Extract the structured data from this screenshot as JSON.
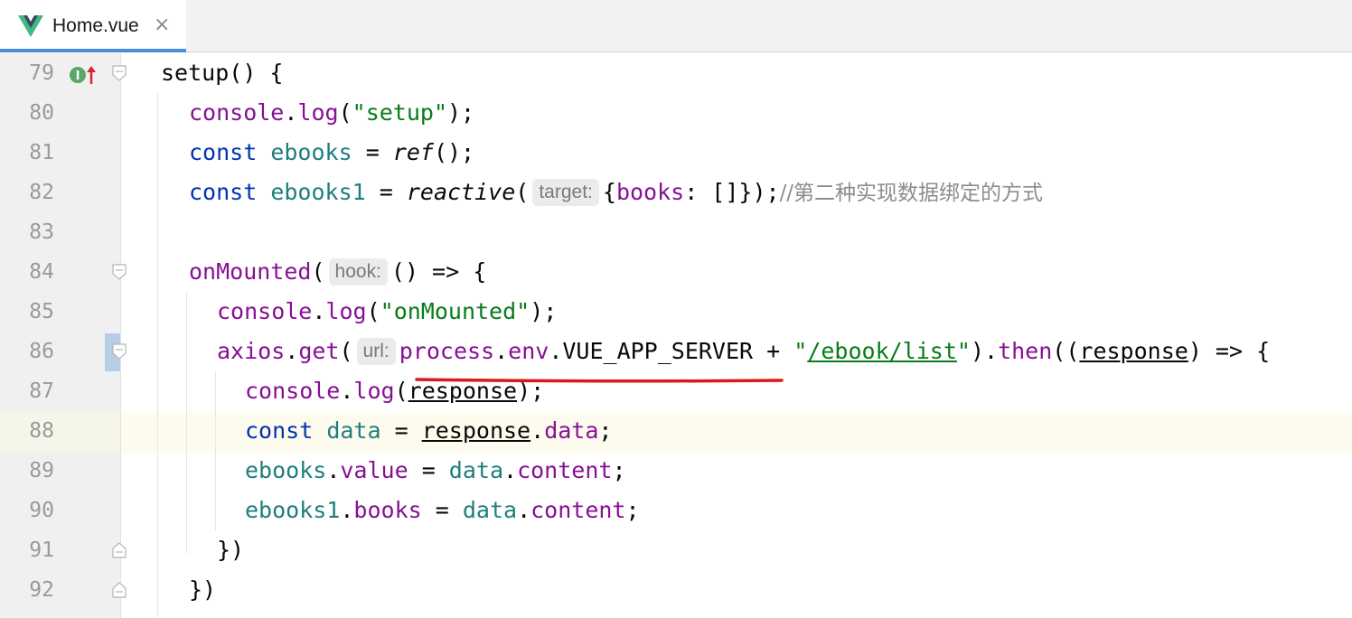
{
  "tab": {
    "label": "Home.vue",
    "icon": "vue-icon",
    "close": "×"
  },
  "colors": {
    "keyword": "#0033b3",
    "function": "#871094",
    "variable": "#1e7e7e",
    "string": "#067d17",
    "comment": "#8c8c8c",
    "underline_mark": "#e0141e"
  },
  "gutter_icons": [
    {
      "line": "79",
      "name": "implementing-method-icon",
      "letter": "I"
    }
  ],
  "lines": [
    {
      "num": "79",
      "t": [
        "setup",
        "() {"
      ]
    },
    {
      "num": "80",
      "t": [
        "console",
        ".",
        "log",
        "(",
        "\"setup\"",
        ");"
      ]
    },
    {
      "num": "81",
      "t": [
        "const",
        " ",
        "ebooks",
        " = ",
        "ref",
        "();"
      ]
    },
    {
      "num": "82",
      "t": [
        "const",
        " ",
        "ebooks1",
        " = ",
        "reactive",
        "(",
        "target:",
        "{",
        "books",
        ": []});",
        "//第二种实现数据绑定的方式"
      ]
    },
    {
      "num": "83",
      "t": []
    },
    {
      "num": "84",
      "t": [
        "onMounted",
        "(",
        "hook:",
        "() => {"
      ]
    },
    {
      "num": "85",
      "t": [
        "console",
        ".",
        "log",
        "(",
        "\"onMounted\"",
        ");"
      ]
    },
    {
      "num": "86",
      "t": [
        "axios",
        ".",
        "get",
        "(",
        "url:",
        "process",
        ".",
        "env",
        ".VUE_APP_SERVER + ",
        "\"",
        "/ebook/list",
        "\"",
        ").",
        "then",
        "((",
        "response",
        ") => {"
      ]
    },
    {
      "num": "87",
      "t": [
        "console",
        ".",
        "log",
        "(",
        "response",
        ");"
      ]
    },
    {
      "num": "88",
      "t": [
        "const",
        " ",
        "data",
        " = ",
        "response",
        ".",
        "data",
        ";"
      ]
    },
    {
      "num": "89",
      "t": [
        "ebooks",
        ".",
        "value",
        " = ",
        "data",
        ".",
        "content",
        ";"
      ]
    },
    {
      "num": "90",
      "t": [
        "ebooks1",
        ".",
        "books",
        " = ",
        "data",
        ".",
        "content",
        ";"
      ]
    },
    {
      "num": "91",
      "t": [
        "})"
      ]
    },
    {
      "num": "92",
      "t": [
        "})"
      ]
    }
  ]
}
